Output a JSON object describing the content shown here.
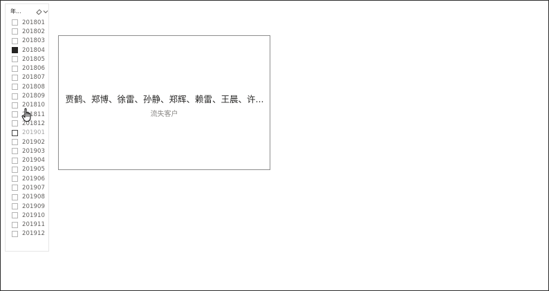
{
  "slicer": {
    "title": "年...",
    "icons": {
      "clear": "eraser-icon",
      "menu": "chevron-down-icon"
    },
    "items": [
      {
        "label": "201801",
        "selected": false
      },
      {
        "label": "201802",
        "selected": false
      },
      {
        "label": "201803",
        "selected": false
      },
      {
        "label": "201804",
        "selected": true
      },
      {
        "label": "201805",
        "selected": false
      },
      {
        "label": "201806",
        "selected": false
      },
      {
        "label": "201807",
        "selected": false
      },
      {
        "label": "201808",
        "selected": false
      },
      {
        "label": "201809",
        "selected": false
      },
      {
        "label": "201810",
        "selected": false
      },
      {
        "label": "201811",
        "selected": false
      },
      {
        "label": "201812",
        "selected": false
      },
      {
        "label": "201901",
        "selected": false,
        "hovered": true
      },
      {
        "label": "201902",
        "selected": false
      },
      {
        "label": "201903",
        "selected": false
      },
      {
        "label": "201904",
        "selected": false
      },
      {
        "label": "201905",
        "selected": false
      },
      {
        "label": "201906",
        "selected": false
      },
      {
        "label": "201907",
        "selected": false
      },
      {
        "label": "201908",
        "selected": false
      },
      {
        "label": "201909",
        "selected": false
      },
      {
        "label": "201910",
        "selected": false
      },
      {
        "label": "201911",
        "selected": false
      },
      {
        "label": "201912",
        "selected": false
      }
    ]
  },
  "card": {
    "value": "贾鹤、郑博、徐雷、孙静、郑辉、赖雷、王晨、许...",
    "label": "流失客户"
  },
  "colors": {
    "selected_fill": "#252423",
    "card_border": "#8c8c8c",
    "label_gray": "#8a8886"
  },
  "cursor": "hand-cursor-icon"
}
